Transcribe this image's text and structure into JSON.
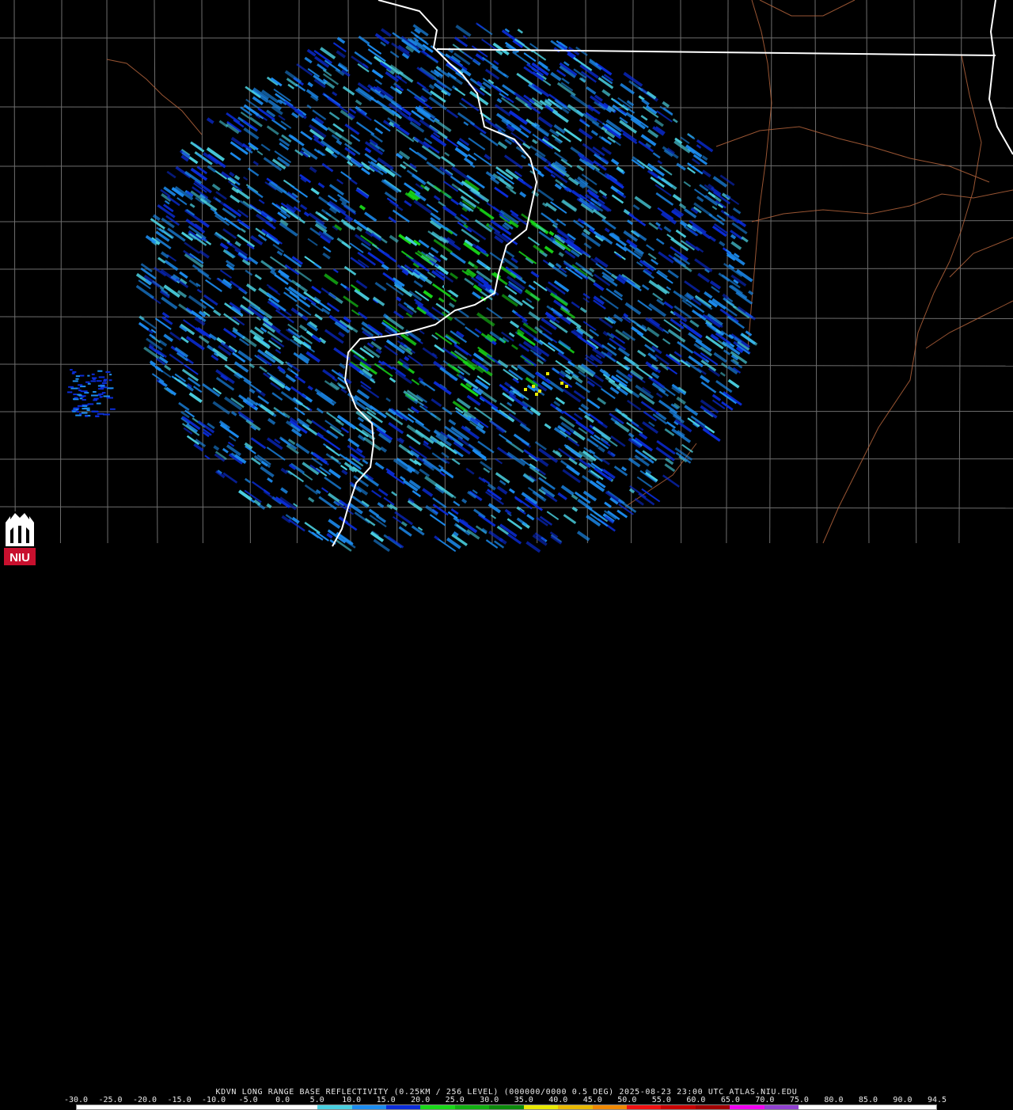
{
  "caption": "KDVN LONG RANGE BASE REFLECTIVITY (0.25KM / 256 LEVEL) (000000/0000 0.5 DEG) 2025-08-23 23:00 UTC  ATLAS.NIU.EDU",
  "legend": {
    "ticks": [
      "-30.0",
      "-25.0",
      "-20.0",
      "-15.0",
      "-10.0",
      "-5.0",
      "0.0",
      "5.0",
      "10.0",
      "15.0",
      "20.0",
      "25.0",
      "30.0",
      "35.0",
      "40.0",
      "45.0",
      "50.0",
      "55.0",
      "60.0",
      "65.0",
      "70.0",
      "75.0",
      "80.0",
      "85.0",
      "90.0",
      "94.5"
    ],
    "colors": [
      "#ffffff",
      "#ffffff",
      "#ffffff",
      "#ffffff",
      "#ffffff",
      "#ffffff",
      "#ffffff",
      "#4ad0e0",
      "#1c8cf0",
      "#0a2cd8",
      "#18d818",
      "#10b010",
      "#0a8a0a",
      "#e8e800",
      "#e8b800",
      "#f08800",
      "#f01010",
      "#c80000",
      "#a00000",
      "#f000f0",
      "#9040d0",
      "#ffffff",
      "#ffffff",
      "#ffffff",
      "#ffffff"
    ]
  },
  "logo": {
    "text": "NIU",
    "icon": "niu-tower-icon"
  },
  "map": {
    "state_border_color": "#ffffff",
    "county_line_color": "#6e6e6e",
    "road_color": "#b4643c",
    "radar_site": "KDVN",
    "echo_colors": [
      "#1c8cf0",
      "#0a2cd8",
      "#4ad0e0",
      "#18d818",
      "#e8e800"
    ]
  }
}
